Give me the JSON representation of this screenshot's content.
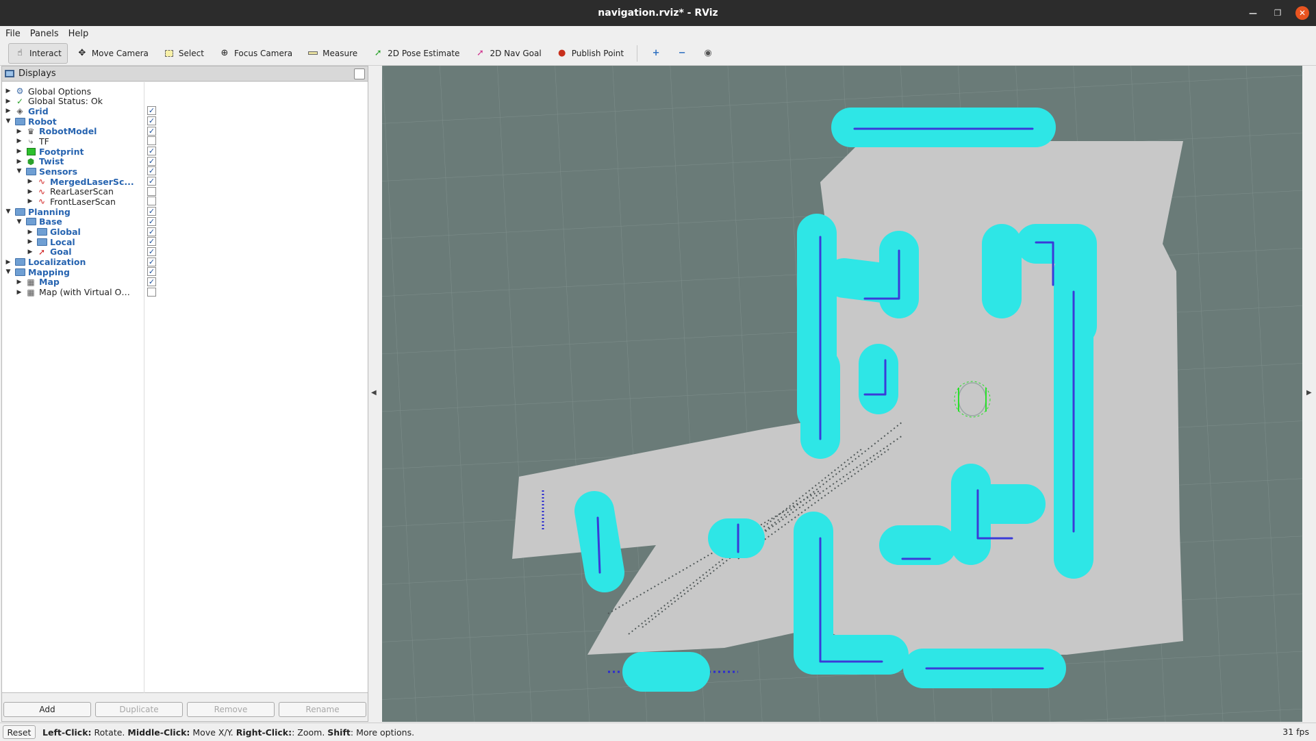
{
  "window": {
    "title": "navigation.rviz* - RViz"
  },
  "menu": {
    "file": "File",
    "panels": "Panels",
    "help": "Help"
  },
  "toolbar": {
    "interact": "Interact",
    "move_camera": "Move Camera",
    "select": "Select",
    "focus_camera": "Focus Camera",
    "measure": "Measure",
    "pose_estimate": "2D Pose Estimate",
    "nav_goal": "2D Nav Goal",
    "publish_point": "Publish Point"
  },
  "displays": {
    "title": "Displays",
    "items": [
      {
        "label": "Global Options",
        "bold": false,
        "checked": null
      },
      {
        "label": "Global Status: Ok",
        "bold": false,
        "checked": null
      },
      {
        "label": "Grid",
        "bold": true,
        "checked": true
      },
      {
        "label": "Robot",
        "bold": true,
        "checked": true
      },
      {
        "label": "RobotModel",
        "bold": true,
        "checked": true
      },
      {
        "label": "TF",
        "bold": false,
        "checked": false
      },
      {
        "label": "Footprint",
        "bold": true,
        "checked": true
      },
      {
        "label": "Twist",
        "bold": true,
        "checked": true
      },
      {
        "label": "Sensors",
        "bold": true,
        "checked": true
      },
      {
        "label": "MergedLaserSc...",
        "bold": true,
        "checked": true
      },
      {
        "label": "RearLaserScan",
        "bold": false,
        "checked": false
      },
      {
        "label": "FrontLaserScan",
        "bold": false,
        "checked": false
      },
      {
        "label": "Planning",
        "bold": true,
        "checked": true
      },
      {
        "label": "Base",
        "bold": true,
        "checked": true
      },
      {
        "label": "Global",
        "bold": true,
        "checked": true
      },
      {
        "label": "Local",
        "bold": true,
        "checked": true
      },
      {
        "label": "Goal",
        "bold": true,
        "checked": true
      },
      {
        "label": "Localization",
        "bold": true,
        "checked": true
      },
      {
        "label": "Mapping",
        "bold": true,
        "checked": true
      },
      {
        "label": "Map",
        "bold": true,
        "checked": true
      },
      {
        "label": "Map (with Virtual Ob...",
        "bold": false,
        "checked": false
      }
    ],
    "buttons": {
      "add": "Add",
      "duplicate": "Duplicate",
      "remove": "Remove",
      "rename": "Rename"
    }
  },
  "status": {
    "reset": "Reset",
    "left_key": "Left-Click:",
    "left_text": " Rotate. ",
    "middle_key": "Middle-Click:",
    "middle_text": " Move X/Y. ",
    "right_key": "Right-Click:",
    "right_text": ": Zoom. ",
    "shift_key": "Shift",
    "shift_text": ": More options.",
    "fps": "31 fps"
  },
  "colors": {
    "view_background": "#6a7b78",
    "free_space": "#c8c8c8",
    "inflation": "#2ee6e6",
    "lethal": "#3a3ad8",
    "obstacle": "#d0368f"
  }
}
